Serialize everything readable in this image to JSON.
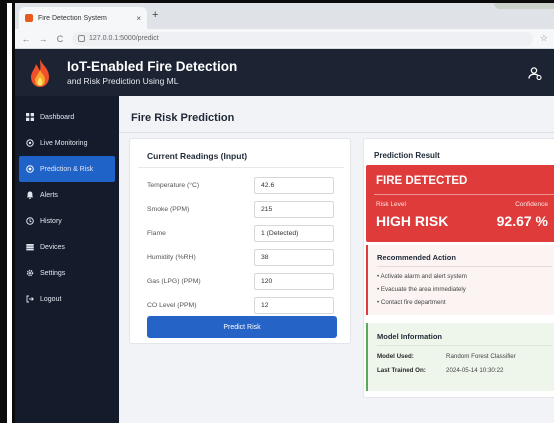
{
  "browser": {
    "tab_title": "Fire Detection System",
    "tab_close": "×",
    "new_tab": "+",
    "back": "←",
    "forward": "→",
    "reload": "C",
    "url": "127.0.0.1:5000/predict",
    "bookmark": "☆"
  },
  "header": {
    "title": "IoT-Enabled Fire Detection",
    "subtitle": "and Risk Prediction Using ML"
  },
  "sidebar": {
    "items": [
      {
        "label": "Dashboard",
        "icon": "grid-icon"
      },
      {
        "label": "Live Monitoring",
        "icon": "live-icon"
      },
      {
        "label": "Prediction & Risk",
        "icon": "target-icon",
        "active": true
      },
      {
        "label": "Alerts",
        "icon": "bell-icon"
      },
      {
        "label": "History",
        "icon": "clock-icon"
      },
      {
        "label": "Devices",
        "icon": "devices-icon"
      },
      {
        "label": "Settings",
        "icon": "gear-icon"
      },
      {
        "label": "Logout",
        "icon": "logout-icon"
      }
    ]
  },
  "main": {
    "page_title": "Fire Risk Prediction",
    "readings": {
      "title": "Current Readings (Input)",
      "rows": [
        {
          "label": "Temperature (°C)",
          "value": "42.6"
        },
        {
          "label": "Smoke (PPM)",
          "value": "215"
        },
        {
          "label": "Flame",
          "value": "1 (Detected)"
        },
        {
          "label": "Humidity (%RH)",
          "value": "38"
        },
        {
          "label": "Gas (LPG) (PPM)",
          "value": "120"
        },
        {
          "label": "CO Level (PPM)",
          "value": "12"
        }
      ],
      "button_label": "Predict Risk"
    },
    "result": {
      "title": "Prediction Result",
      "status": "FIRE DETECTED",
      "risk_label": "Risk Level",
      "risk_value": "HIGH RISK",
      "confidence_label": "Confidence",
      "confidence_value": "92.67 %",
      "recommended_title": "Recommended Action",
      "actions": [
        "Activate alarm and alert system",
        "Evacuate the area immediately",
        "Contact fire department"
      ],
      "model_title": "Model Information",
      "model_used_label": "Model Used:",
      "model_used_value": "Random Forest Classifier",
      "trained_label": "Last Trained On:",
      "trained_value": "2024-05-14 10:30:22"
    }
  },
  "colors": {
    "header_bg": "#1c2434",
    "sidebar_bg": "#141c2c",
    "active_item": "#1f62c8",
    "alert_red": "#df3b3b",
    "button_blue": "#2563c7",
    "model_green": "#5aa85a"
  }
}
